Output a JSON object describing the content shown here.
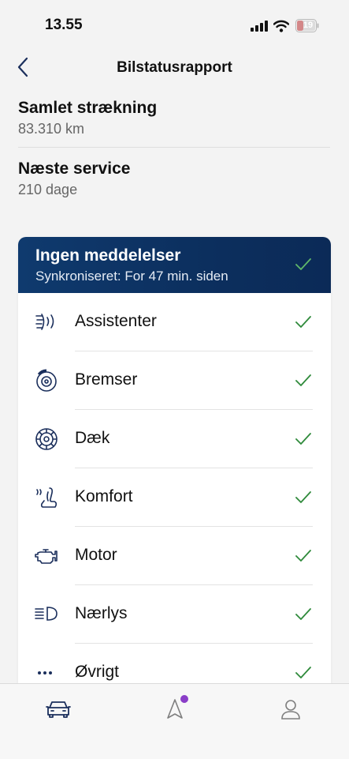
{
  "status_bar": {
    "time": "13.55",
    "battery": "19",
    "battery_color": "#e0393a"
  },
  "header": {
    "title": "Bilstatusrapport"
  },
  "summary": [
    {
      "label": "Samlet strækning",
      "value": "83.310 km"
    },
    {
      "label": "Næste service",
      "value": "210 dage"
    }
  ],
  "card": {
    "title": "Ingen meddelelser",
    "subtitle": "Synkroniseret: For 47 min. siden",
    "header_color": "#0c2f5e",
    "check_color": "#2f8a3b",
    "items": [
      {
        "label": "Assistenter",
        "icon": "driver-assist-icon"
      },
      {
        "label": "Bremser",
        "icon": "brake-disc-icon"
      },
      {
        "label": "Dæk",
        "icon": "tire-icon"
      },
      {
        "label": "Komfort",
        "icon": "seat-heating-icon"
      },
      {
        "label": "Motor",
        "icon": "engine-icon"
      },
      {
        "label": "Nærlys",
        "icon": "low-beam-icon"
      },
      {
        "label": "Øvrigt",
        "icon": "more-icon"
      }
    ]
  },
  "tab_bar": {
    "tabs": [
      {
        "name": "car",
        "icon": "car-icon",
        "active": true
      },
      {
        "name": "navigation",
        "icon": "navigation-icon",
        "badge_color": "#8a3ec8"
      },
      {
        "name": "profile",
        "icon": "user-icon"
      }
    ]
  }
}
